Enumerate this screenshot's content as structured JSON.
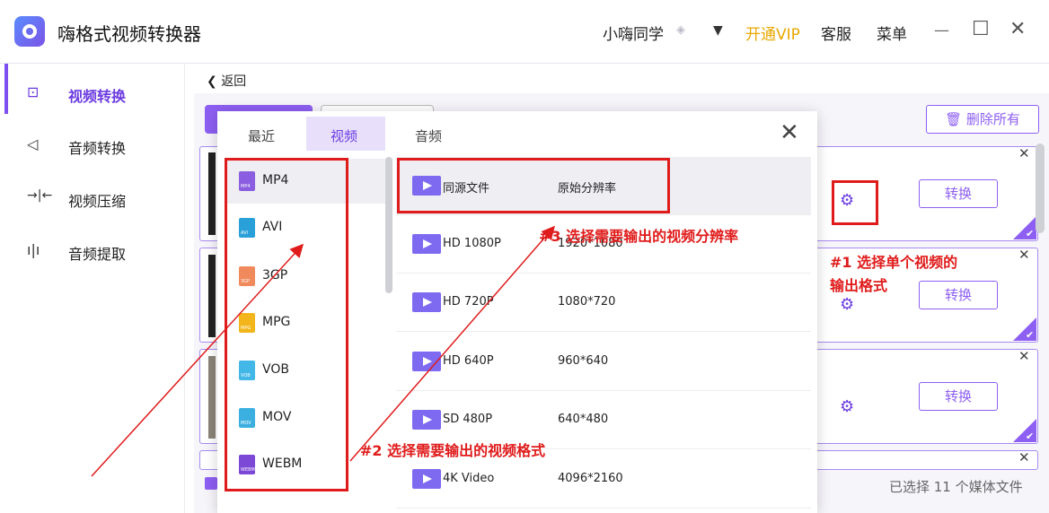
{
  "app": {
    "title": "嗨格式视频转换器"
  },
  "titlebar": {
    "user": "小嗨同学",
    "vip": "开通VIP",
    "service": "客服",
    "menu": "菜单",
    "minimize": "—",
    "maximize": "☐",
    "close": "✕"
  },
  "sidebar": {
    "items": [
      {
        "label": "视频转换",
        "icon": "video-convert-icon",
        "glyph": "⊡"
      },
      {
        "label": "音频转换",
        "icon": "audio-convert-icon",
        "glyph": "◁"
      },
      {
        "label": "视频压缩",
        "icon": "compress-icon",
        "glyph": "→|←"
      },
      {
        "label": "音频提取",
        "icon": "audio-extract-icon",
        "glyph": "ı|ı"
      }
    ]
  },
  "main": {
    "back": "返回",
    "delete_all": "删除所有",
    "convert": "转换",
    "status": "已选择 11 个媒体文件"
  },
  "popup": {
    "tabs": [
      "最近",
      "视频",
      "音频"
    ],
    "close": "✕",
    "formats": [
      {
        "label": "MP4",
        "color": "#8b5de0"
      },
      {
        "label": "AVI",
        "color": "#2aa0d8"
      },
      {
        "label": "3GP",
        "color": "#f08a5d"
      },
      {
        "label": "MPG",
        "color": "#f2b61c"
      },
      {
        "label": "VOB",
        "color": "#43b7e8"
      },
      {
        "label": "MOV",
        "color": "#3bb0e0"
      },
      {
        "label": "WEBM",
        "color": "#7c48d6"
      }
    ],
    "resolutions": [
      {
        "name": "同源文件",
        "value": "原始分辨率"
      },
      {
        "name": "HD 1080P",
        "value": "1920*1080"
      },
      {
        "name": "HD 720P",
        "value": "1080*720"
      },
      {
        "name": "HD 640P",
        "value": "960*640"
      },
      {
        "name": "SD 480P",
        "value": "640*480"
      },
      {
        "name": "4K Video",
        "value": "4096*2160"
      }
    ]
  },
  "annotations": {
    "note1_line1": "#1 选择单个视频的",
    "note1_line2": "输出格式",
    "note2": "#2 选择需要输出的视频格式",
    "note3": "#3 选择需要输出的视频分辨率"
  },
  "colors": {
    "accent": "#8d5ff2",
    "annotation": "#e01b1b",
    "vip": "#e9a800"
  }
}
